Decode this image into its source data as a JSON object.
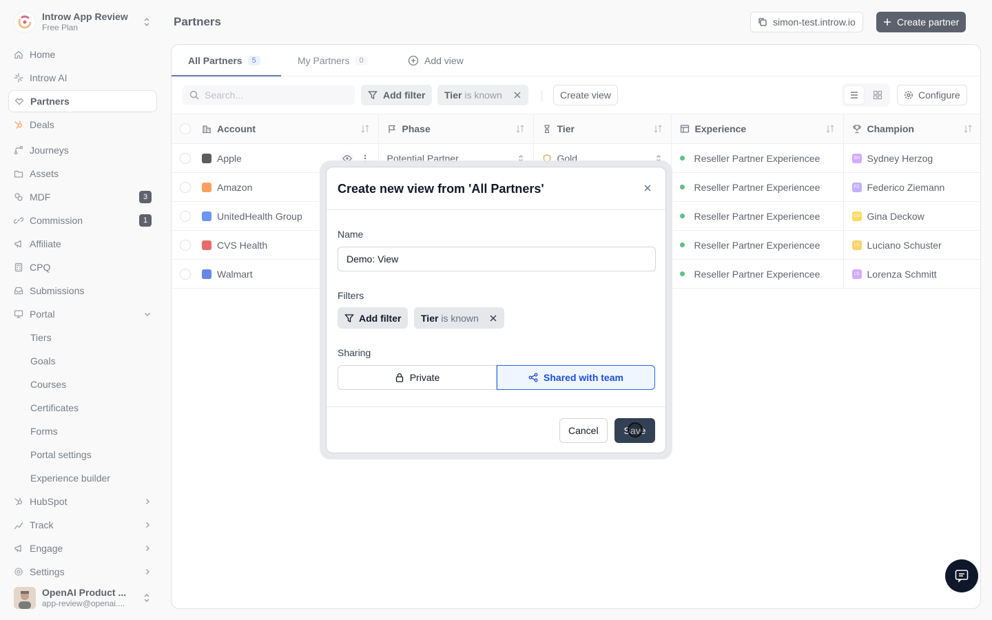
{
  "workspace": {
    "name": "Introw App Review",
    "plan": "Free Plan"
  },
  "sidebar": {
    "items": [
      {
        "label": "Home",
        "icon": "home-icon"
      },
      {
        "label": "Introw AI",
        "icon": "sparkle-icon"
      },
      {
        "label": "Partners",
        "icon": "handshake-icon",
        "active": true
      },
      {
        "label": "Deals",
        "icon": "hubspot-icon"
      },
      {
        "label": "Journeys",
        "icon": "route-icon"
      },
      {
        "label": "Assets",
        "icon": "folder-icon"
      },
      {
        "label": "MDF",
        "icon": "coins-icon",
        "badge": "3"
      },
      {
        "label": "Commission",
        "icon": "link-icon",
        "badge": "1"
      },
      {
        "label": "Affiliate",
        "icon": "megaphone-icon"
      },
      {
        "label": "CPQ",
        "icon": "calculator-icon"
      },
      {
        "label": "Submissions",
        "icon": "inbox-icon"
      },
      {
        "label": "Portal",
        "icon": "monitor-icon"
      }
    ],
    "portal_sub": [
      "Tiers",
      "Goals",
      "Courses",
      "Certificates",
      "Forms",
      "Portal settings",
      "Experience builder"
    ],
    "bottom_items": [
      {
        "label": "HubSpot",
        "icon": "hubspot-icon"
      },
      {
        "label": "Track",
        "icon": "chart-icon"
      },
      {
        "label": "Engage",
        "icon": "megaphone-icon"
      },
      {
        "label": "Settings",
        "icon": "gear-icon"
      }
    ]
  },
  "user": {
    "name": "OpenAI Product ...",
    "email": "app-review@openai...."
  },
  "header": {
    "title": "Partners",
    "domain": "simon-test.introw.io",
    "create_label": "Create partner"
  },
  "tabs": [
    {
      "label": "All Partners",
      "count": "5"
    },
    {
      "label": "My Partners",
      "count": "0"
    }
  ],
  "add_view_label": "Add view",
  "toolbar": {
    "search_placeholder": "Search...",
    "add_filter": "Add filter",
    "filter_field": "Tier",
    "filter_op": "is known",
    "create_view": "Create view",
    "configure": "Configure"
  },
  "table": {
    "columns": [
      "Account",
      "Phase",
      "Tier",
      "Experience",
      "Champion"
    ],
    "rows": [
      {
        "account": "Apple",
        "logo_color": "#111111",
        "phase": "Potential Partner",
        "tier": "Gold",
        "experience": "Reseller Partner Experiencee",
        "champion": "Sydney Herzog",
        "ini": "SH",
        "ini_color": "#c084fc"
      },
      {
        "account": "Amazon",
        "logo_color": "#f97316",
        "phase": "",
        "tier": "",
        "experience": "Reseller Partner Experiencee",
        "champion": "Federico Ziemann",
        "ini": "FZ",
        "ini_color": "#a78bfa"
      },
      {
        "account": "UnitedHealth Group",
        "logo_color": "#2563eb",
        "phase": "",
        "tier": "",
        "experience": "Reseller Partner Experiencee",
        "champion": "Gina Deckow",
        "ini": "GD",
        "ini_color": "#facc15"
      },
      {
        "account": "CVS Health",
        "logo_color": "#dc2626",
        "phase": "",
        "tier": "",
        "experience": "Reseller Partner Experiencee",
        "champion": "Luciano Schuster",
        "ini": "LS",
        "ini_color": "#fbbf24"
      },
      {
        "account": "Walmart",
        "logo_color": "#1d4ed8",
        "phase": "",
        "tier": "",
        "experience": "Reseller Partner Experiencee",
        "champion": "Lorenza Schmitt",
        "ini": "LS",
        "ini_color": "#c084fc"
      }
    ]
  },
  "modal": {
    "title": "Create new view from 'All Partners'",
    "name_label": "Name",
    "name_value": "Demo: View",
    "filters_label": "Filters",
    "add_filter": "Add filter",
    "filter_field": "Tier",
    "filter_op": "is known",
    "sharing_label": "Sharing",
    "private_label": "Private",
    "shared_label": "Shared with team",
    "cancel_label": "Cancel",
    "save_label": "Save"
  },
  "colors": {
    "accent": "#0f172a",
    "selected_blue": "#2563eb",
    "save_bg": "#334155"
  }
}
